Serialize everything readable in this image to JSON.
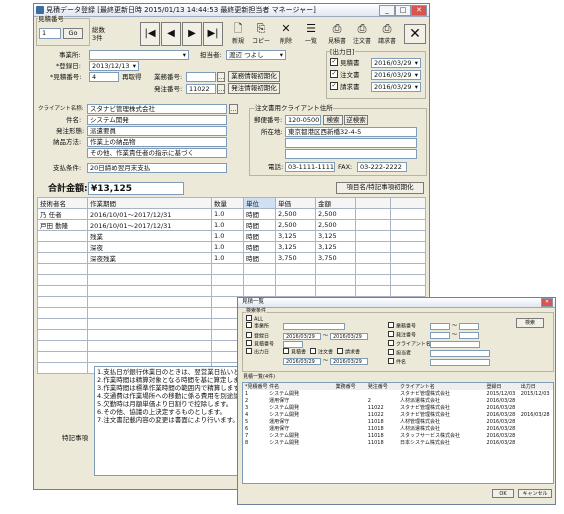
{
  "main": {
    "title": "見積データ登録 [最終更新日時 2015/01/13 14:44:53 最終更新担当者 マネージャー]",
    "mitsumori_group": "見積番号",
    "mitsumori_no": "1",
    "go": "Go",
    "count_label": "総数",
    "count_value": "3件",
    "tb_new": "新規",
    "tb_copy": "コピー",
    "tb_delete": "削除",
    "tb_list": "一覧",
    "tb_print_estimate": "見積書",
    "tb_print_order": "注文書",
    "tb_print_invoice": "請求書",
    "jigyosho_label": "事業所:",
    "tanto_label": "担当者:",
    "tanto_value": "渡辺 つよし",
    "toroku_label": "*登録日:",
    "toroku_value": "2013/12/13",
    "mitsumori_label": "*見積番号:",
    "mitsumori_value": "4",
    "saisaiban": "再取得",
    "gyomu_label": "業務番号:",
    "hacchu_label": "発注番号:",
    "hacchu_value": "11022",
    "gyomu_clear": "業務情報初期化",
    "hacchu_clear": "発注情報初期化",
    "output_title": "[出力日]",
    "out_estimate_label": "見積書",
    "out_estimate_date": "2016/03/29",
    "out_order_label": "注文書",
    "out_order_date": "2016/03/29",
    "out_invoice_label": "請求書",
    "out_invoice_date": "2016/03/29",
    "client_label": "クライアント名称:",
    "client_value": "スタナビ管理株式会社",
    "kenmei_label": "件名:",
    "kenmei_value": "システム開発",
    "keitai_label": "発注形態:",
    "keitai_value": "派遣要員",
    "nohin_label": "納品方法:",
    "nohin_value": "作業上の納品物",
    "nohin_value2": "その他、作業責任者の指示に基づく",
    "shiharai_label": "支払条件:",
    "shiharai_value": "20日締め翌月末支払",
    "addr_title": "注文書用クライアント住所",
    "zip_label": "郵便番号:",
    "zip_value": "120-0500",
    "zip_btn1": "検索",
    "zip_btn2": "逆検索",
    "addr_label": "所在地:",
    "addr_value": "東京都港区西新橋32-4-5",
    "tel_label": "電話:",
    "tel_value": "03-1111-1111",
    "fax_label": "FAX:",
    "fax_value": "03-222-2222",
    "total_label": "合計金額:",
    "total_value": "¥13,125",
    "reset_btn": "項目名/特記事項初期化",
    "table_headers": [
      "技術者名",
      "作業期間",
      "数量",
      "単位",
      "単価",
      "金額"
    ],
    "rows": [
      [
        "乃 任者",
        "2016/10/01〜2017/12/31",
        "1.0",
        "時間",
        "2,500",
        "2,500"
      ],
      [
        "戸田 勤隆",
        "2016/10/01〜2017/12/31",
        "1.0",
        "時間",
        "2,500",
        "2,500"
      ],
      [
        "",
        "残業",
        "1.0",
        "時間",
        "3,125",
        "3,125"
      ],
      [
        "",
        "深夜",
        "1.0",
        "時間",
        "3,125",
        "3,125"
      ],
      [
        "",
        "深夜残業",
        "1.0",
        "時間",
        "3,750",
        "3,750"
      ]
    ],
    "notes_label": "特記事項",
    "notes": [
      "1.支払日が銀行休業日のときは、翌営業日払いとします。",
      "2.作業時間は精算対象となる時間を基に算定します。",
      "3.作業時間は標準作業時間の範囲内で精算します。",
      "4.交通費は作業場所への移動に係る費用を別途請求します。",
      "5.欠勤時は月額単価より日割りで控除します。",
      "6.その他、協議の上決定するものとします。",
      "7.注文書記載内容の変更は書面により行います。"
    ]
  },
  "search": {
    "title": "見積一覧",
    "cond_title": "検索条件",
    "chk_all": "ALL",
    "chk_jigyosho": "事業所",
    "chk_toroku": "登録日",
    "toroku_from": "2016/03/29",
    "toroku_to": "2016/03/29",
    "chk_mitsumori": "見積番号",
    "chk_output": "出力日",
    "out_est": "見積書",
    "out_ord": "注文書",
    "out_inv": "請求書",
    "out_from": "2016/03/29",
    "out_to": "2016/03/29",
    "chk_gyomu": "業務番号",
    "chk_hacchu": "発注番号",
    "chk_client": "クライアント名",
    "chk_tanto": "担当者",
    "chk_kenmei": "件名",
    "search_btn": "検索",
    "list_title": "見積一覧(4件)",
    "list_headers": [
      "*見積番号",
      "件名",
      "業務番号",
      "発注番号",
      "クライアント名",
      "登録日",
      "出力日"
    ],
    "list_rows": [
      [
        "1",
        "システム開発",
        "",
        "",
        "スタナビ管理株式会社",
        "2015/12/03",
        "2015/12/03"
      ],
      [
        "2",
        "運用保守",
        "",
        "2",
        "人材派遣株式会社",
        "2016/03/28",
        ""
      ],
      [
        "3",
        "システム開発",
        "",
        "11022",
        "スタナビ管理株式会社",
        "2016/03/28",
        ""
      ],
      [
        "4",
        "システム開発",
        "",
        "11022",
        "スタナビ管理株式会社",
        "2016/03/28",
        "2016/03/28"
      ],
      [
        "5",
        "運用保守",
        "",
        "11018",
        "人材管理株式会社",
        "2016/03/28",
        ""
      ],
      [
        "6",
        "運用保守",
        "",
        "11018",
        "人材派遣株式会社",
        "2016/03/28",
        ""
      ],
      [
        "7",
        "システム開発",
        "",
        "11018",
        "スタッフサービス株式会社",
        "2016/03/28",
        ""
      ],
      [
        "8",
        "システム開発",
        "",
        "11018",
        "日本システム株式会社",
        "2016/03/28",
        ""
      ]
    ],
    "ok_btn": "OK",
    "cancel_btn": "キャンセル"
  }
}
